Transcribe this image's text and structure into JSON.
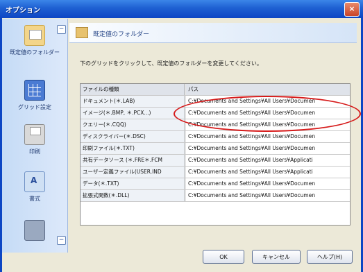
{
  "window": {
    "title": "オプション",
    "close_label": "×"
  },
  "sidebar": {
    "items": [
      {
        "label": "既定値のフォルダー",
        "icon": "folder-icon",
        "selected": true
      },
      {
        "label": "グリッド設定",
        "icon": "grid-icon"
      },
      {
        "label": "印刷",
        "icon": "printer-icon"
      },
      {
        "label": "書式",
        "icon": "format-icon"
      },
      {
        "label": "",
        "icon": "database-icon"
      }
    ],
    "collapse_top": "−",
    "collapse_bottom": "−"
  },
  "header": {
    "title": "既定値のフォルダー"
  },
  "instruction": "下のグリッドをクリックして、既定値のフォルダーを変更してください。",
  "table": {
    "columns": [
      "ファイルの種類",
      "パス"
    ],
    "rows": [
      [
        "ドキュメント(＊.LAB)",
        "C:¥Documents and Settings¥All Users¥Documen"
      ],
      [
        "イメージ(＊.BMP, ＊.PCX...)",
        "C:¥Documents and Settings¥All Users¥Documen"
      ],
      [
        "クエリー(＊.CQQ)",
        "C:¥Documents and Settings¥All Users¥Documen"
      ],
      [
        "ディスクライバー(＊.DSC)",
        "C:¥Documents and Settings¥All Users¥Documen"
      ],
      [
        "印刷ファイル(＊.TXT)",
        "C:¥Documents and Settings¥All Users¥Documen"
      ],
      [
        "共有データソース (＊.FRE＊.FCM",
        "C:¥Documents and Settings¥All Users¥Applicati"
      ],
      [
        "ユーザー定義ファイル(USER.IND",
        "C:¥Documents and Settings¥All Users¥Applicati"
      ],
      [
        "データ(＊.TXT)",
        "C:¥Documents and Settings¥All Users¥Documen"
      ],
      [
        "拡張式関数(＊.DLL)",
        "C:¥Documents and Settings¥All Users¥Documen"
      ]
    ]
  },
  "buttons": {
    "ok": "OK",
    "cancel": "キャンセル",
    "help": "ヘルプ(H)"
  },
  "colors": {
    "titlebar": "#1e5fd2",
    "highlight": "#d61a1a",
    "sidebar": "#c5dbf6"
  }
}
